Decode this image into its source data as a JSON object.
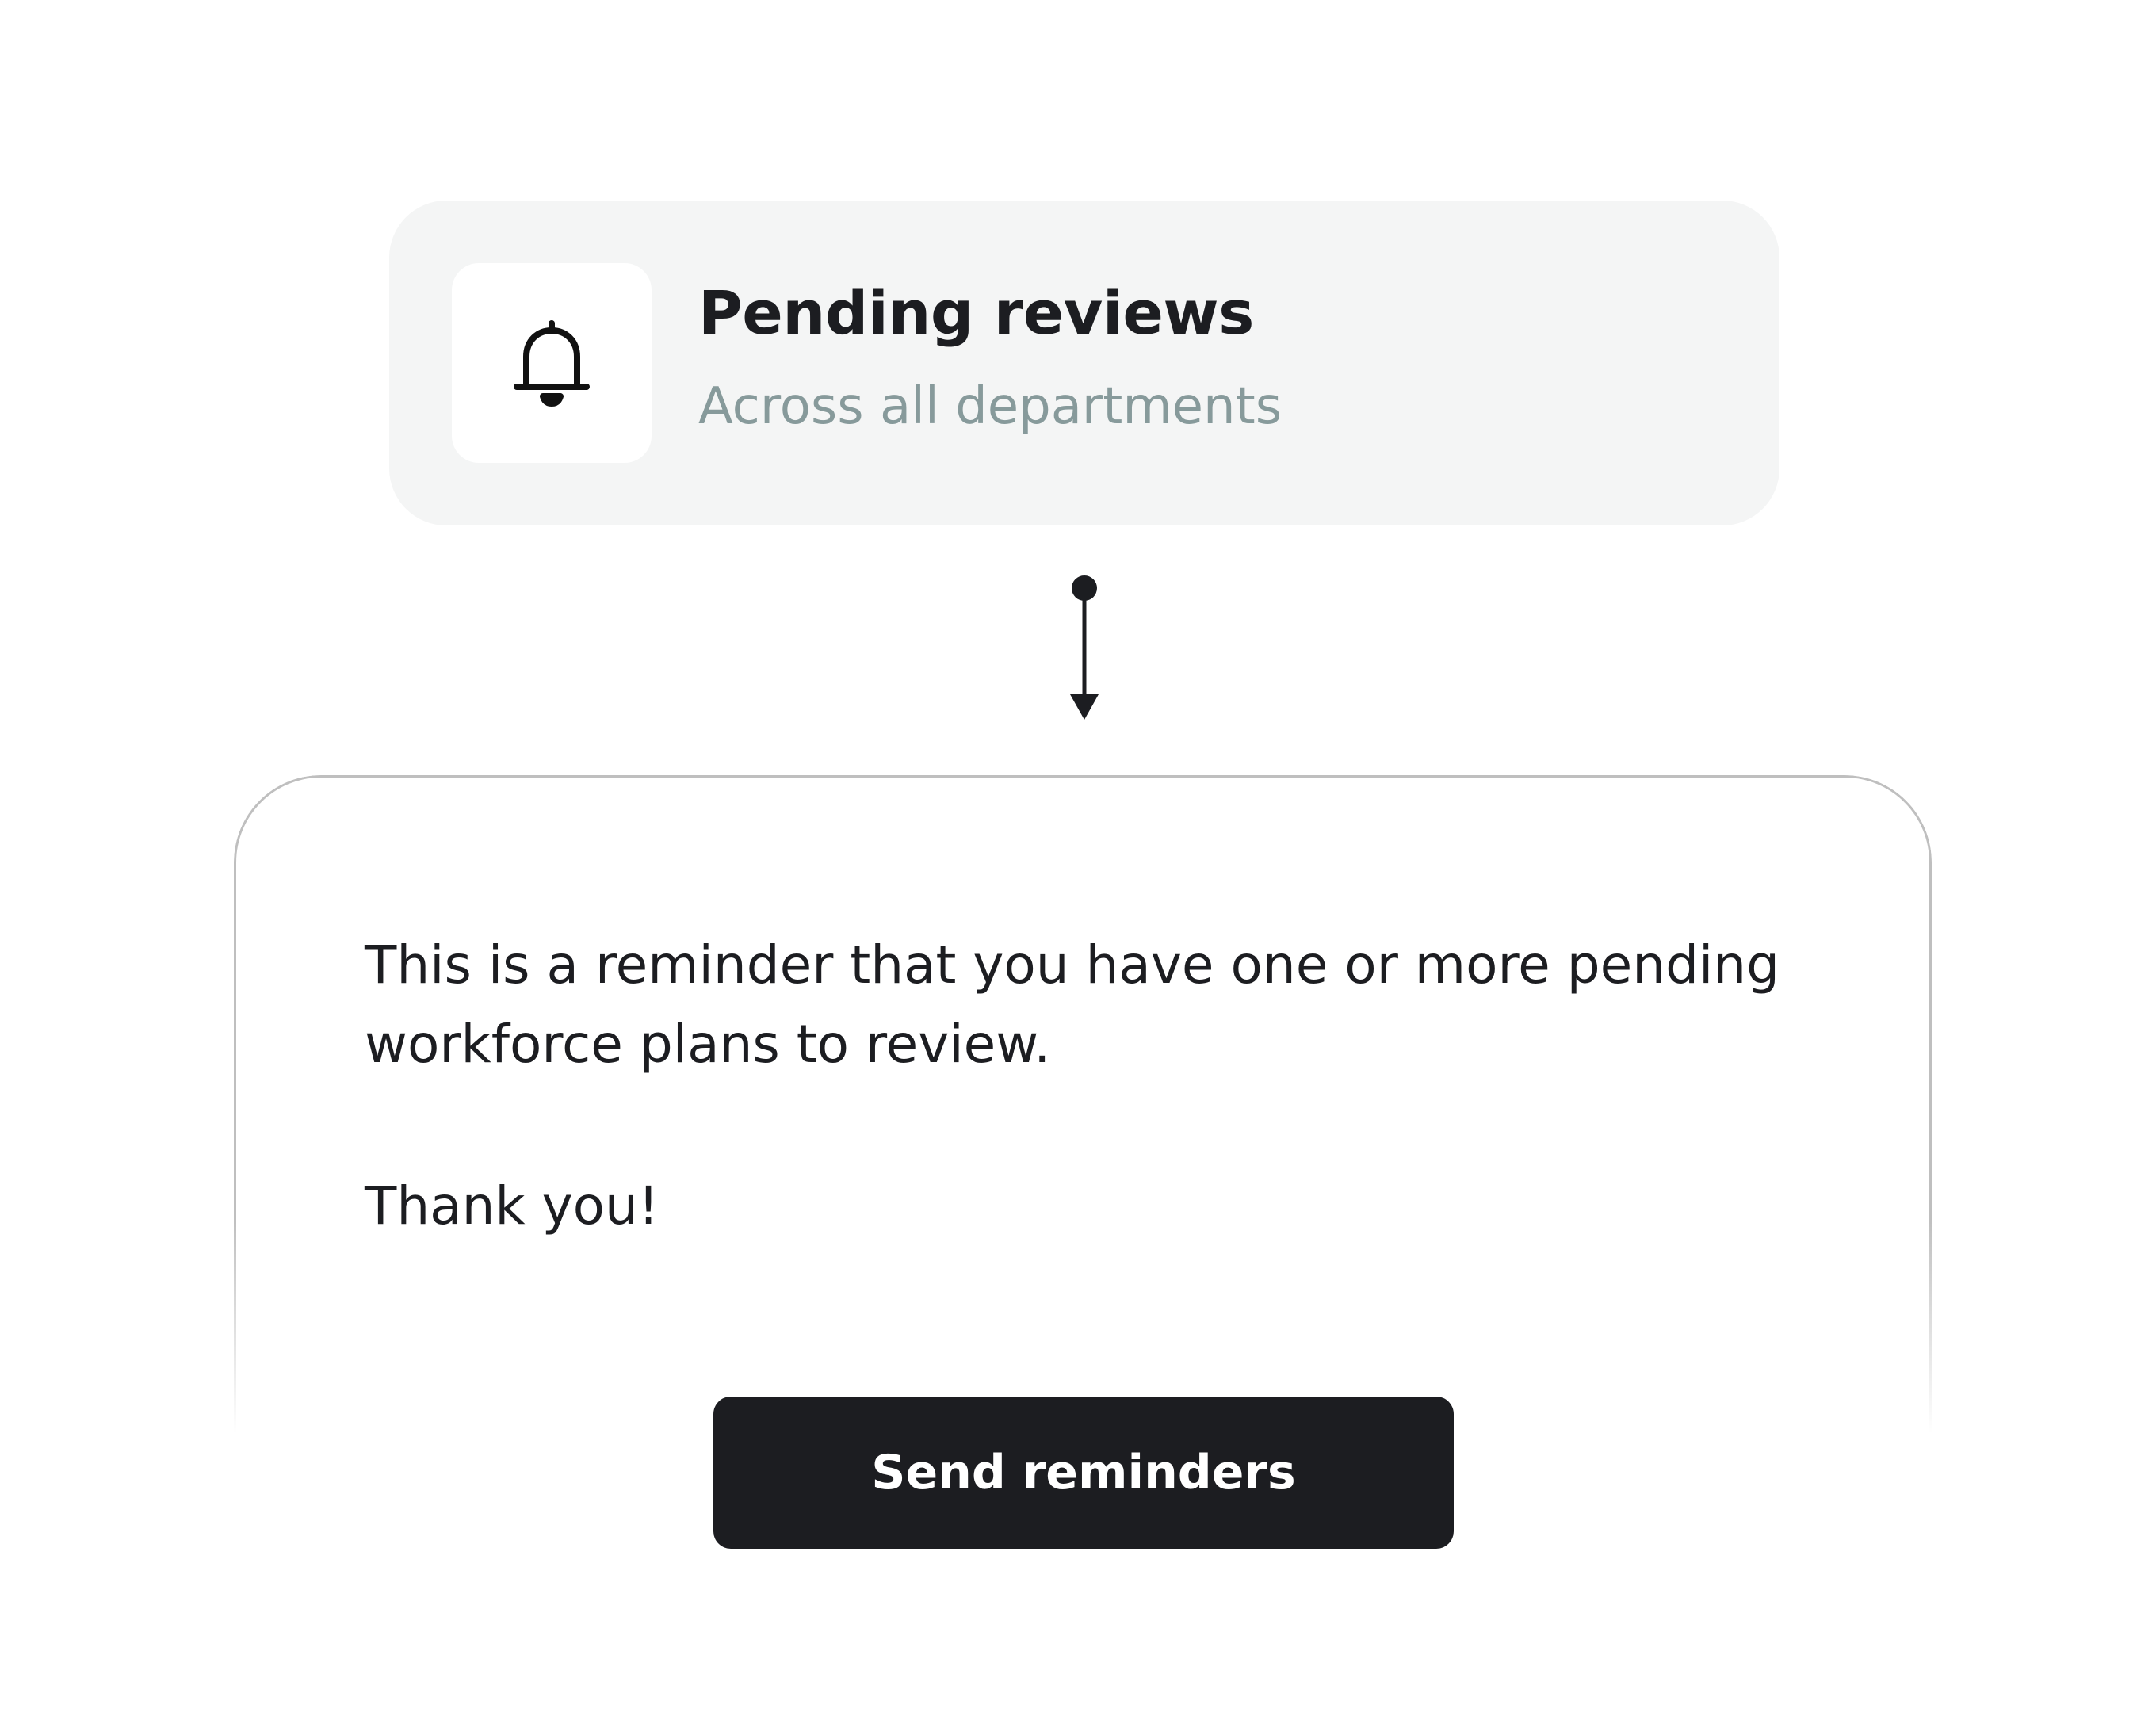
{
  "notification": {
    "icon": "bell-icon",
    "title": "Pending reviews",
    "subtitle": "Across all departments"
  },
  "message": {
    "body": "This is a reminder that you have one or more pending workforce plans to review.",
    "closing": "Thank you!"
  },
  "actions": {
    "send_label": "Send reminders"
  },
  "colors": {
    "card_background": "#f4f5f5",
    "title_text": "#1c1d21",
    "subtitle_text": "#879a9b",
    "button_background": "#1c1d21",
    "button_text": "#ffffff",
    "card_border": "#bfbfbf"
  }
}
